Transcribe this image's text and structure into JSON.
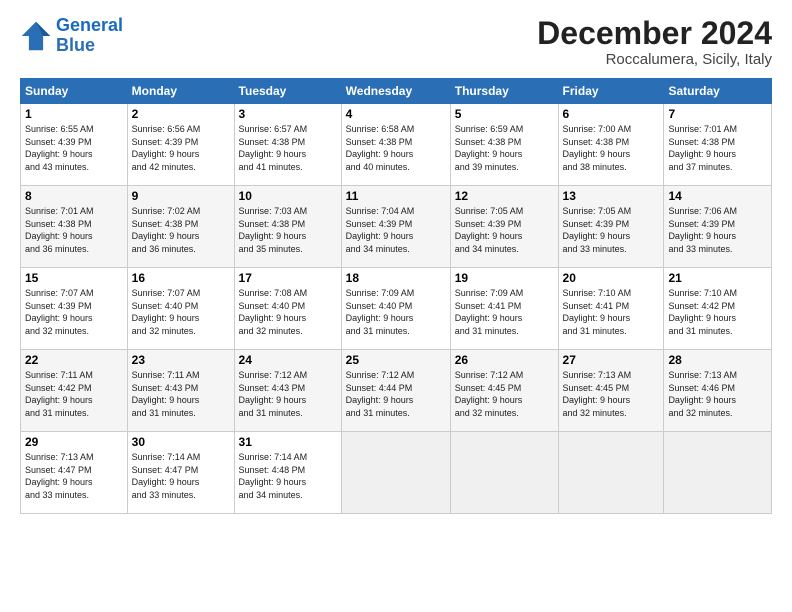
{
  "header": {
    "logo_line1": "General",
    "logo_line2": "Blue",
    "title": "December 2024",
    "location": "Roccalumera, Sicily, Italy"
  },
  "days_of_week": [
    "Sunday",
    "Monday",
    "Tuesday",
    "Wednesday",
    "Thursday",
    "Friday",
    "Saturday"
  ],
  "weeks": [
    [
      {
        "day": 1,
        "sr": "6:55 AM",
        "ss": "4:39 PM",
        "dl": "9 hours and 43 minutes."
      },
      {
        "day": 2,
        "sr": "6:56 AM",
        "ss": "4:39 PM",
        "dl": "9 hours and 42 minutes."
      },
      {
        "day": 3,
        "sr": "6:57 AM",
        "ss": "4:38 PM",
        "dl": "9 hours and 41 minutes."
      },
      {
        "day": 4,
        "sr": "6:58 AM",
        "ss": "4:38 PM",
        "dl": "9 hours and 40 minutes."
      },
      {
        "day": 5,
        "sr": "6:59 AM",
        "ss": "4:38 PM",
        "dl": "9 hours and 39 minutes."
      },
      {
        "day": 6,
        "sr": "7:00 AM",
        "ss": "4:38 PM",
        "dl": "9 hours and 38 minutes."
      },
      {
        "day": 7,
        "sr": "7:01 AM",
        "ss": "4:38 PM",
        "dl": "9 hours and 37 minutes."
      }
    ],
    [
      {
        "day": 8,
        "sr": "7:01 AM",
        "ss": "4:38 PM",
        "dl": "9 hours and 36 minutes."
      },
      {
        "day": 9,
        "sr": "7:02 AM",
        "ss": "4:38 PM",
        "dl": "9 hours and 36 minutes."
      },
      {
        "day": 10,
        "sr": "7:03 AM",
        "ss": "4:38 PM",
        "dl": "9 hours and 35 minutes."
      },
      {
        "day": 11,
        "sr": "7:04 AM",
        "ss": "4:39 PM",
        "dl": "9 hours and 34 minutes."
      },
      {
        "day": 12,
        "sr": "7:05 AM",
        "ss": "4:39 PM",
        "dl": "9 hours and 34 minutes."
      },
      {
        "day": 13,
        "sr": "7:05 AM",
        "ss": "4:39 PM",
        "dl": "9 hours and 33 minutes."
      },
      {
        "day": 14,
        "sr": "7:06 AM",
        "ss": "4:39 PM",
        "dl": "9 hours and 33 minutes."
      }
    ],
    [
      {
        "day": 15,
        "sr": "7:07 AM",
        "ss": "4:39 PM",
        "dl": "9 hours and 32 minutes."
      },
      {
        "day": 16,
        "sr": "7:07 AM",
        "ss": "4:40 PM",
        "dl": "9 hours and 32 minutes."
      },
      {
        "day": 17,
        "sr": "7:08 AM",
        "ss": "4:40 PM",
        "dl": "9 hours and 32 minutes."
      },
      {
        "day": 18,
        "sr": "7:09 AM",
        "ss": "4:40 PM",
        "dl": "9 hours and 31 minutes."
      },
      {
        "day": 19,
        "sr": "7:09 AM",
        "ss": "4:41 PM",
        "dl": "9 hours and 31 minutes."
      },
      {
        "day": 20,
        "sr": "7:10 AM",
        "ss": "4:41 PM",
        "dl": "9 hours and 31 minutes."
      },
      {
        "day": 21,
        "sr": "7:10 AM",
        "ss": "4:42 PM",
        "dl": "9 hours and 31 minutes."
      }
    ],
    [
      {
        "day": 22,
        "sr": "7:11 AM",
        "ss": "4:42 PM",
        "dl": "9 hours and 31 minutes."
      },
      {
        "day": 23,
        "sr": "7:11 AM",
        "ss": "4:43 PM",
        "dl": "9 hours and 31 minutes."
      },
      {
        "day": 24,
        "sr": "7:12 AM",
        "ss": "4:43 PM",
        "dl": "9 hours and 31 minutes."
      },
      {
        "day": 25,
        "sr": "7:12 AM",
        "ss": "4:44 PM",
        "dl": "9 hours and 31 minutes."
      },
      {
        "day": 26,
        "sr": "7:12 AM",
        "ss": "4:45 PM",
        "dl": "9 hours and 32 minutes."
      },
      {
        "day": 27,
        "sr": "7:13 AM",
        "ss": "4:45 PM",
        "dl": "9 hours and 32 minutes."
      },
      {
        "day": 28,
        "sr": "7:13 AM",
        "ss": "4:46 PM",
        "dl": "9 hours and 32 minutes."
      }
    ],
    [
      {
        "day": 29,
        "sr": "7:13 AM",
        "ss": "4:47 PM",
        "dl": "9 hours and 33 minutes."
      },
      {
        "day": 30,
        "sr": "7:14 AM",
        "ss": "4:47 PM",
        "dl": "9 hours and 33 minutes."
      },
      {
        "day": 31,
        "sr": "7:14 AM",
        "ss": "4:48 PM",
        "dl": "9 hours and 34 minutes."
      },
      null,
      null,
      null,
      null
    ]
  ]
}
